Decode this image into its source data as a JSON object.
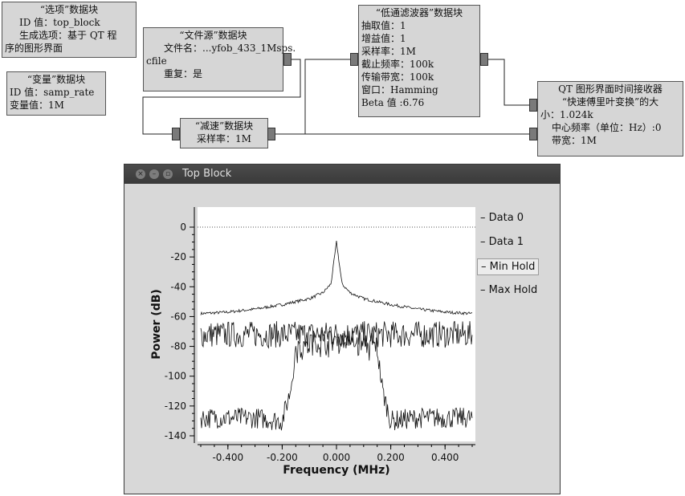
{
  "flowgraph": {
    "options_block": {
      "title": "“选项”数据块",
      "id_line": "ID 值：top_block",
      "gen_line1": "生成选项：基于 QT 程",
      "gen_line2": "序的图形界面"
    },
    "variable_block": {
      "title": "“变量”数据块",
      "id_line": "ID 值：samp_rate",
      "value_line": "变量值：1M"
    },
    "file_source_block": {
      "title": "“文件源”数据块",
      "file_line": "文件名：...yfob_433_1Msps.",
      "file_line2": "cfile",
      "repeat_line": "重复：是"
    },
    "throttle_block": {
      "title": "“减速”数据块",
      "rate_line": "采样率：1M"
    },
    "lowpass_block": {
      "title": "“低通滤波器”数据块",
      "lines": [
        "抽取值：1",
        "增益值：1",
        "采样率：1M",
        "截止频率：100k",
        "传输带宽：100k",
        "窗口：Hamming",
        "Beta 值 :6.76"
      ]
    },
    "qt_sink_block": {
      "line1": "QT 图形界面时间接收器",
      "line2": "“快速傅里叶变换”的大",
      "line3": "小：1.024k",
      "line4": "中心频率（单位：Hz）:0",
      "line5": "带宽：1M"
    }
  },
  "window": {
    "title": "Top Block",
    "close_glyph": "×",
    "min_glyph": "–",
    "max_glyph": "▫"
  },
  "chart_data": {
    "type": "line",
    "title": "",
    "xlabel": "Frequency (MHz)",
    "ylabel": "Power (dB)",
    "xlim": [
      -0.5,
      0.5
    ],
    "ylim": [
      -140,
      0
    ],
    "x_ticks": [
      "-0.400",
      "-0.200",
      "0.000",
      "0.200",
      "0.400"
    ],
    "x_tick_values": [
      -0.4,
      -0.2,
      0.0,
      0.2,
      0.4
    ],
    "y_ticks": [
      "0",
      "-20",
      "-40",
      "-60",
      "-80",
      "-100",
      "-120",
      "-140"
    ],
    "y_tick_values": [
      0,
      -20,
      -40,
      -60,
      -80,
      -100,
      -120,
      -140
    ],
    "legend": [
      "Data 0",
      "Data 1",
      "Min Hold",
      "Max Hold"
    ],
    "legend_highlighted": "Min Hold",
    "reference_line_y": 0,
    "series": [
      {
        "name": "Data 0",
        "description_points": {
          "x": [
            -0.5,
            -0.4,
            -0.3,
            -0.2,
            -0.1,
            -0.05,
            -0.02,
            0.0,
            0.02,
            0.05,
            0.1,
            0.2,
            0.3,
            0.4,
            0.5
          ],
          "y": [
            -58,
            -57,
            -55,
            -52,
            -48,
            -44,
            -38,
            -10,
            -38,
            -44,
            -48,
            -52,
            -55,
            -57,
            -58
          ]
        }
      },
      {
        "name": "Data 1",
        "description_points": {
          "x": [
            -0.5,
            -0.4,
            -0.3,
            -0.2,
            -0.1,
            0.0,
            0.1,
            0.2,
            0.3,
            0.4,
            0.5
          ],
          "y": [
            -72,
            -72,
            -72,
            -72,
            -72,
            -72,
            -72,
            -72,
            -72,
            -72,
            -72
          ]
        }
      },
      {
        "name": "Min Hold",
        "description_points": {
          "x": [
            -0.5,
            -0.3,
            -0.2,
            -0.17,
            -0.15,
            -0.1,
            0.0,
            0.1,
            0.15,
            0.17,
            0.2,
            0.3,
            0.5
          ],
          "y": [
            -128,
            -128,
            -130,
            -110,
            -82,
            -78,
            -75,
            -78,
            -82,
            -110,
            -130,
            -128,
            -128
          ]
        }
      }
    ]
  }
}
